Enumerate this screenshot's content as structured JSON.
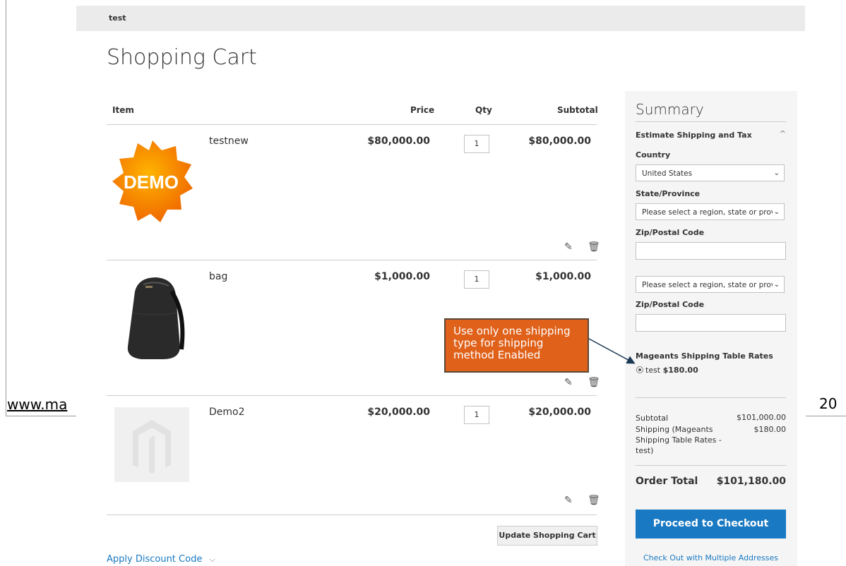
{
  "document": {
    "url_text": "www.ma",
    "page_number": "20"
  },
  "header": {
    "store_label": "test",
    "page_title": "Shopping Cart"
  },
  "table": {
    "headers": {
      "item": "Item",
      "price": "Price",
      "qty": "Qty",
      "subtotal": "Subtotal"
    },
    "rows": [
      {
        "name": "testnew",
        "price": "$80,000.00",
        "qty": "1",
        "subtotal": "$80,000.00",
        "image": "demo-badge-image"
      },
      {
        "name": "bag",
        "price": "$1,000.00",
        "qty": "1",
        "subtotal": "$1,000.00",
        "image": "backpack-image"
      },
      {
        "name": "Demo2",
        "price": "$20,000.00",
        "qty": "1",
        "subtotal": "$20,000.00",
        "image": "placeholder-image"
      }
    ],
    "demo_badge_text": "DEMO"
  },
  "actions": {
    "update_cart": "Update Shopping Cart",
    "apply_discount": "Apply Discount Code"
  },
  "summary": {
    "title": "Summary",
    "estimate_title": "Estimate Shipping and Tax",
    "country_label": "Country",
    "country_value": "United States",
    "state_label": "State/Province",
    "state_placeholder": "Please select a region, state or provi",
    "zip_label": "Zip/Postal Code",
    "state_placeholder_2": "Please select a region, state or provi",
    "zip_label_2": "Zip/Postal Code",
    "shipping_method_title": "Mageants Shipping Table Rates",
    "shipping_option_name": "test",
    "shipping_option_price": "$180.00",
    "subtotal_label": "Subtotal",
    "subtotal_value": "$101,000.00",
    "shipping_label": "Shipping (Mageants Shipping Table Rates - test)",
    "shipping_value": "$180.00",
    "order_total_label": "Order Total",
    "order_total_value": "$101,180.00",
    "checkout_button": "Proceed to Checkout",
    "multi_address_link": "Check Out with Multiple Addresses"
  },
  "callout": {
    "text": "Use only one shipping type for shipping method Enabled"
  },
  "colors": {
    "accent": "#1979c3",
    "callout": "#e0611a",
    "topbar": "#ebebeb",
    "summary_bg": "#f5f5f5"
  }
}
